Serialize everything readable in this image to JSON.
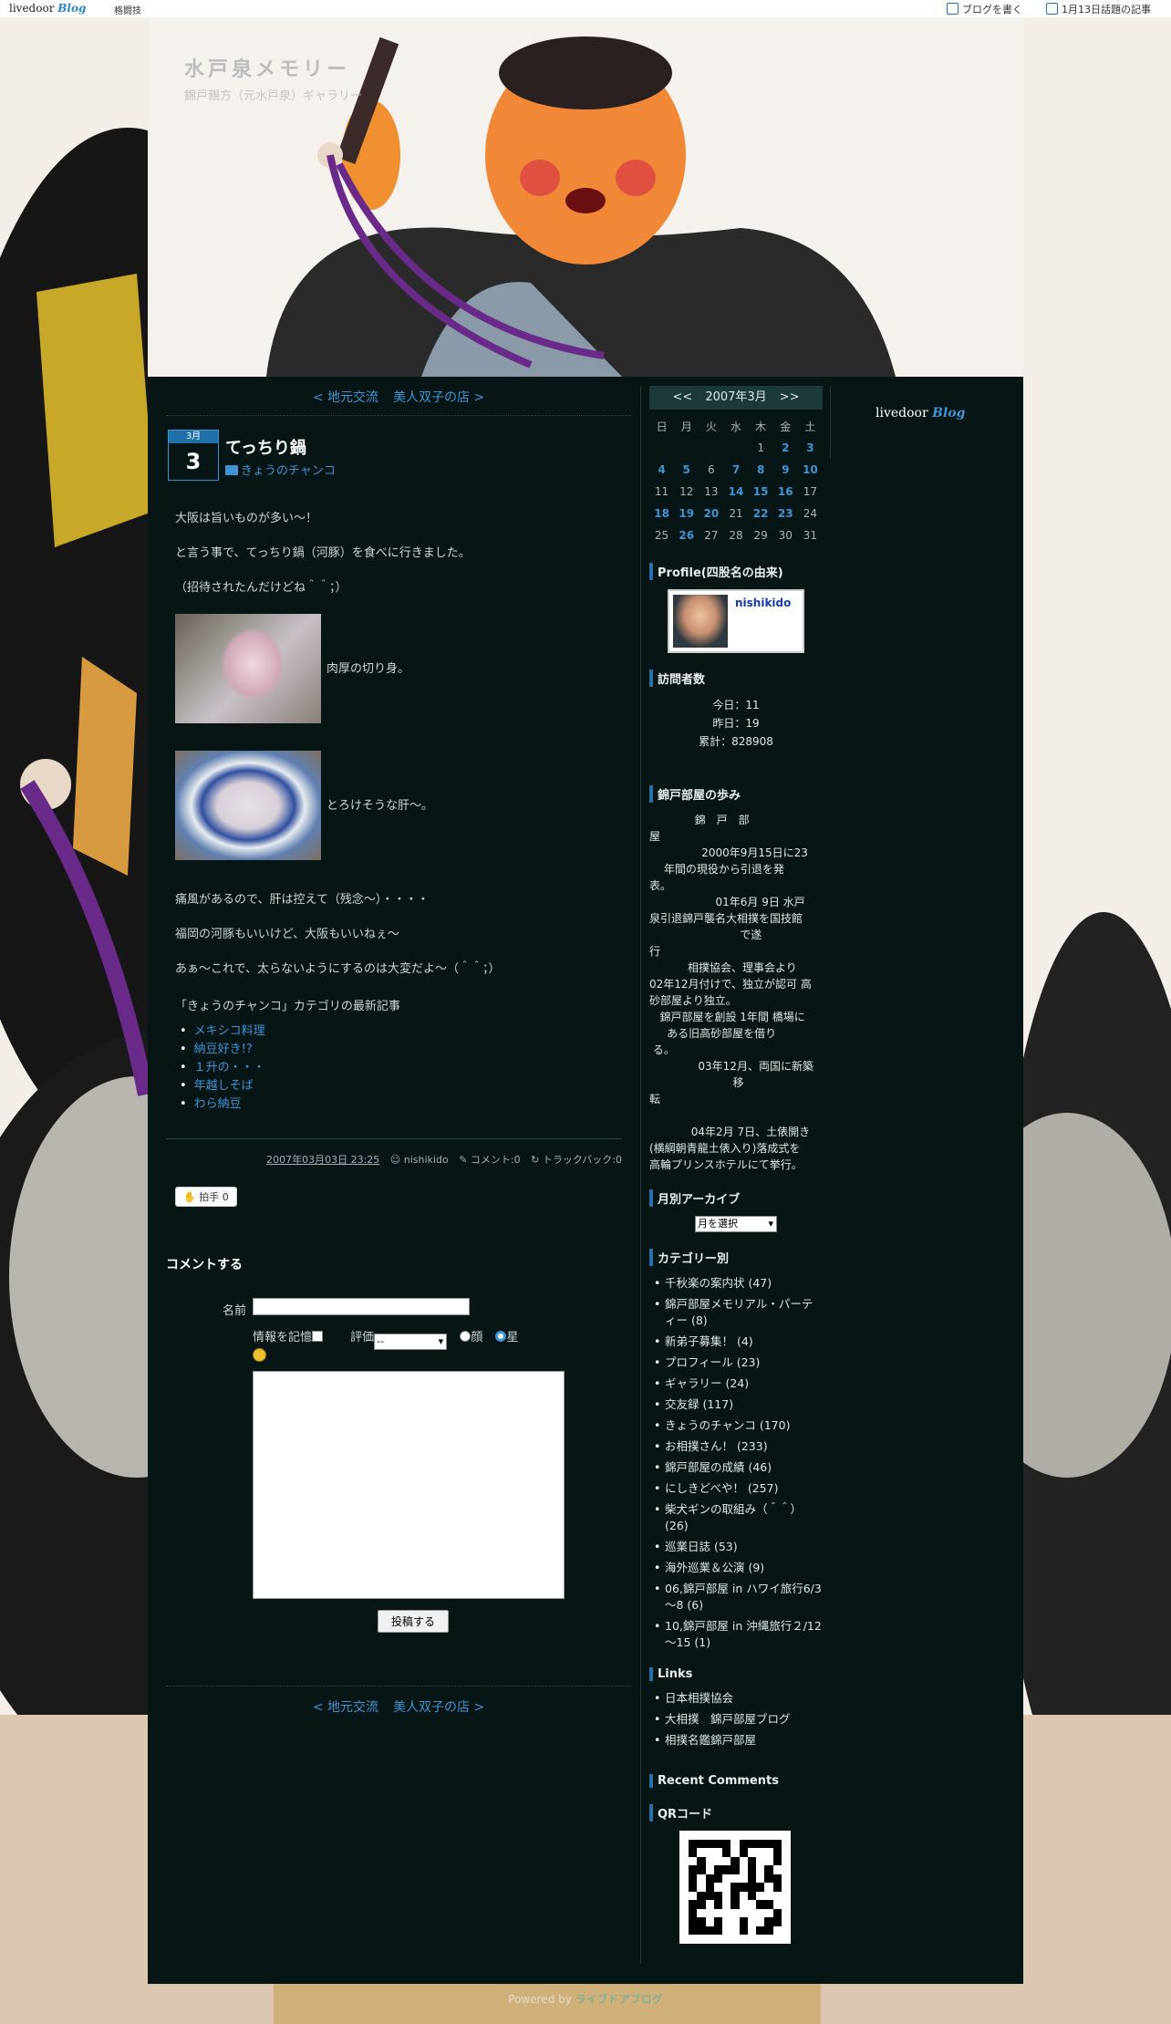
{
  "topbar": {
    "logo_brand": "livedoor",
    "logo_suffix": "Blog",
    "category": "格闘技",
    "write_link": "ブログを書く",
    "news_link": "1月13日話題の記事"
  },
  "header": {
    "title": "水戸泉メモリー",
    "description": "錦戸親方（元水戸泉）ギャラリー"
  },
  "nav": {
    "prev": "< 地元交流",
    "next": "美人双子の店 >"
  },
  "entry": {
    "month": "3月",
    "day": "3",
    "title": "てっちり鍋",
    "category": "きょうのチャンコ",
    "paras_before": [
      "大阪は旨いものが多い～！",
      "と言う事で、てっちり鍋（河豚）を食べに行きました。",
      "（招待されたんだけどね＾＾；）"
    ],
    "img1_caption": "肉厚の切り身。",
    "img2_caption": "とろけそうな肝～。",
    "paras_after": [
      "痛風があるので、肝は控えて（残念～）・・・・",
      "福岡の河豚もいいけど、大阪もいいねぇ～",
      "あぁ～これで、太らないようにするのは大変だよ～（＾＾；）"
    ],
    "latest_title": "「きょうのチャンコ」カテゴリの最新記事",
    "latest": [
      "メキシコ料理",
      "納豆好き!?",
      "１升の・・・",
      "年越しそば",
      "わら納豆"
    ],
    "meta_date": "2007年03月03日 23:25",
    "meta_author": "nishikido",
    "meta_comments": "コメント:0",
    "meta_tb": "トラックバック:0",
    "clap": "拍手",
    "clap_count": "0"
  },
  "comment": {
    "heading": "コメントする",
    "name_label": "名前",
    "remember": "情報を記憶",
    "rating_label": "評価",
    "rating_value": "--",
    "face": "顔",
    "star": "星",
    "submit": "投稿する"
  },
  "calendar": {
    "prev": "<<",
    "title": "2007年3月",
    "next": ">>",
    "weekdays": [
      "日",
      "月",
      "火",
      "水",
      "木",
      "金",
      "土"
    ],
    "weeks": [
      [
        "",
        "",
        "",
        "",
        "1",
        "2",
        "3"
      ],
      [
        "4",
        "5",
        "6",
        "7",
        "8",
        "9",
        "10"
      ],
      [
        "11",
        "12",
        "13",
        "14",
        "15",
        "16",
        "17"
      ],
      [
        "18",
        "19",
        "20",
        "21",
        "22",
        "23",
        "24"
      ],
      [
        "25",
        "26",
        "27",
        "28",
        "29",
        "30",
        "31"
      ]
    ],
    "linked": [
      "2",
      "3",
      "4",
      "5",
      "7",
      "8",
      "9",
      "10",
      "14",
      "15",
      "16",
      "18",
      "19",
      "20",
      "22",
      "23",
      "26"
    ]
  },
  "profile": {
    "heading": "Profile(四股名の由来)",
    "name": "nishikido"
  },
  "visitors": {
    "heading": "訪問者数",
    "today": "今日：11",
    "yesterday": "昨日：19",
    "total": "累計：828908"
  },
  "history": {
    "heading": "錦戸部屋の歩み",
    "text": "             錦　戸　部\n屋\n               2000年9月15日に23\n　 年間の現役から引退を発\n表。\n                   01年6月 9日 水戸\n泉引退錦戸襲名大相撲を国技館\n                          で遂\n行\n           相撲協会、理事会より\n02年12月付けで、独立が認可 高\n砂部屋より独立。\n   錦戸部屋を創設 1年間 橋場に\n     ある旧高砂部屋を借り\n る。\n              03年12月、両国に新築\n                        移\n転\n\n            04年2月 7日、土俵開き\n(横綱朝青龍土俵入り)落成式を\n高輪プリンスホテルにて挙行。"
  },
  "archive": {
    "heading": "月別アーカイブ",
    "select": "月を選択"
  },
  "categories": {
    "heading": "カテゴリー別",
    "items": [
      "千秋楽の案内状 (47)",
      "錦戸部屋メモリアル・パーティー (8)",
      "新弟子募集！ (4)",
      "プロフィール (23)",
      "ギャラリー (24)",
      "交友録 (117)",
      "きょうのチャンコ (170)",
      "お相撲さん！ (233)",
      "錦戸部屋の成績 (46)",
      "にしきどべや！ (257)",
      "柴犬ギンの取組み（＾＾） (26)",
      "巡業日誌 (53)",
      "海外巡業＆公演 (9)",
      "06,錦戸部屋 in ハワイ旅行6/3～8 (6)",
      "10,錦戸部屋 in 沖縄旅行２/12～15 (1)"
    ]
  },
  "links": {
    "heading": "Links",
    "items": [
      "日本相撲協会",
      "大相撲　錦戸部屋ブログ",
      "相撲名鑑錦戸部屋"
    ]
  },
  "recent": {
    "heading": "Recent Comments"
  },
  "qr": {
    "heading": "QRコード"
  },
  "footer": {
    "prefix": "Powered by ",
    "link": "ライブドアブログ"
  },
  "colors": {
    "page_bg": "#071515",
    "link": "#3d95d4",
    "accent": "#2a6fa8"
  }
}
